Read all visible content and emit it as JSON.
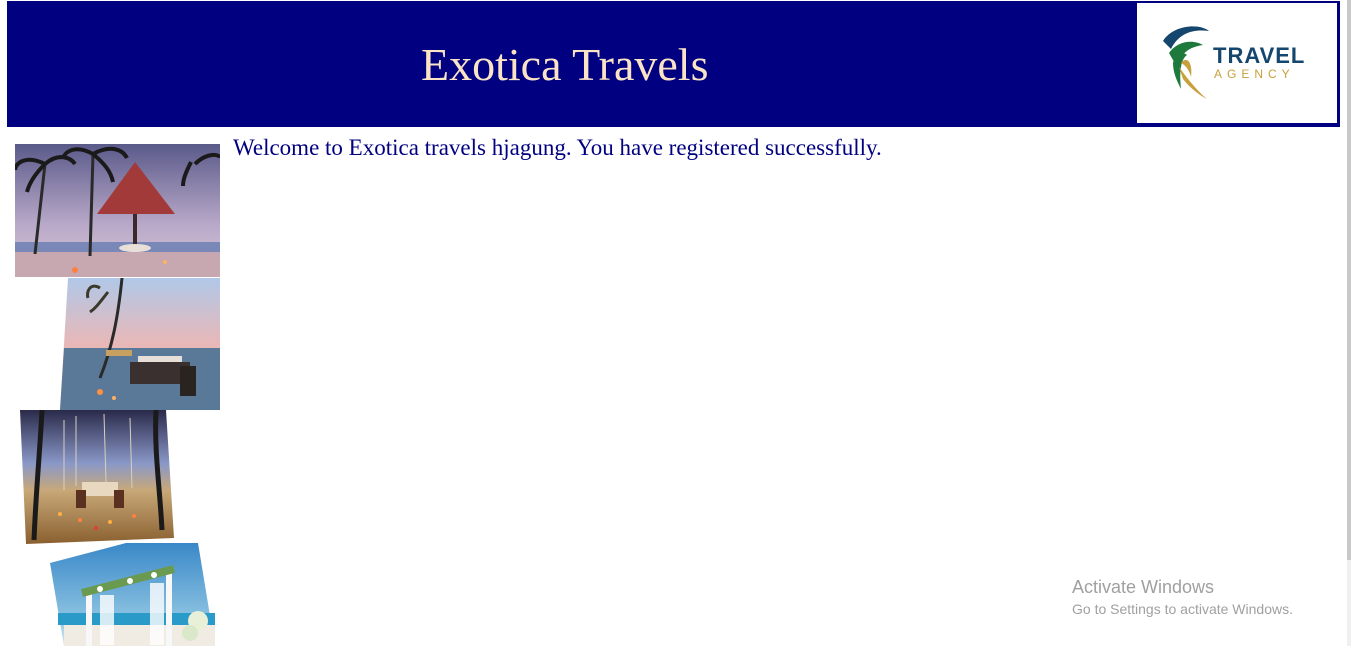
{
  "header": {
    "title": "Exotica Travels",
    "background_color": "#000080",
    "title_color": "#fbe3c6"
  },
  "logo": {
    "word1": "TRAVEL",
    "word2": "AGENCY",
    "primary_color": "#15466e",
    "accent_color": "#c8a03c",
    "leaf_color": "#1e7a3c"
  },
  "main": {
    "welcome_message": "Welcome to Exotica travels hjagung. You have registered successfully.",
    "text_color": "#000080"
  },
  "gallery": {
    "photos": [
      {
        "icon": "beach-hut-sunset-photo"
      },
      {
        "icon": "beach-dinner-swing-photo"
      },
      {
        "icon": "candlelit-beach-dinner-photo"
      },
      {
        "icon": "beach-wedding-arch-photo"
      }
    ]
  },
  "watermark": {
    "title": "Activate Windows",
    "subtitle": "Go to Settings to activate Windows."
  }
}
